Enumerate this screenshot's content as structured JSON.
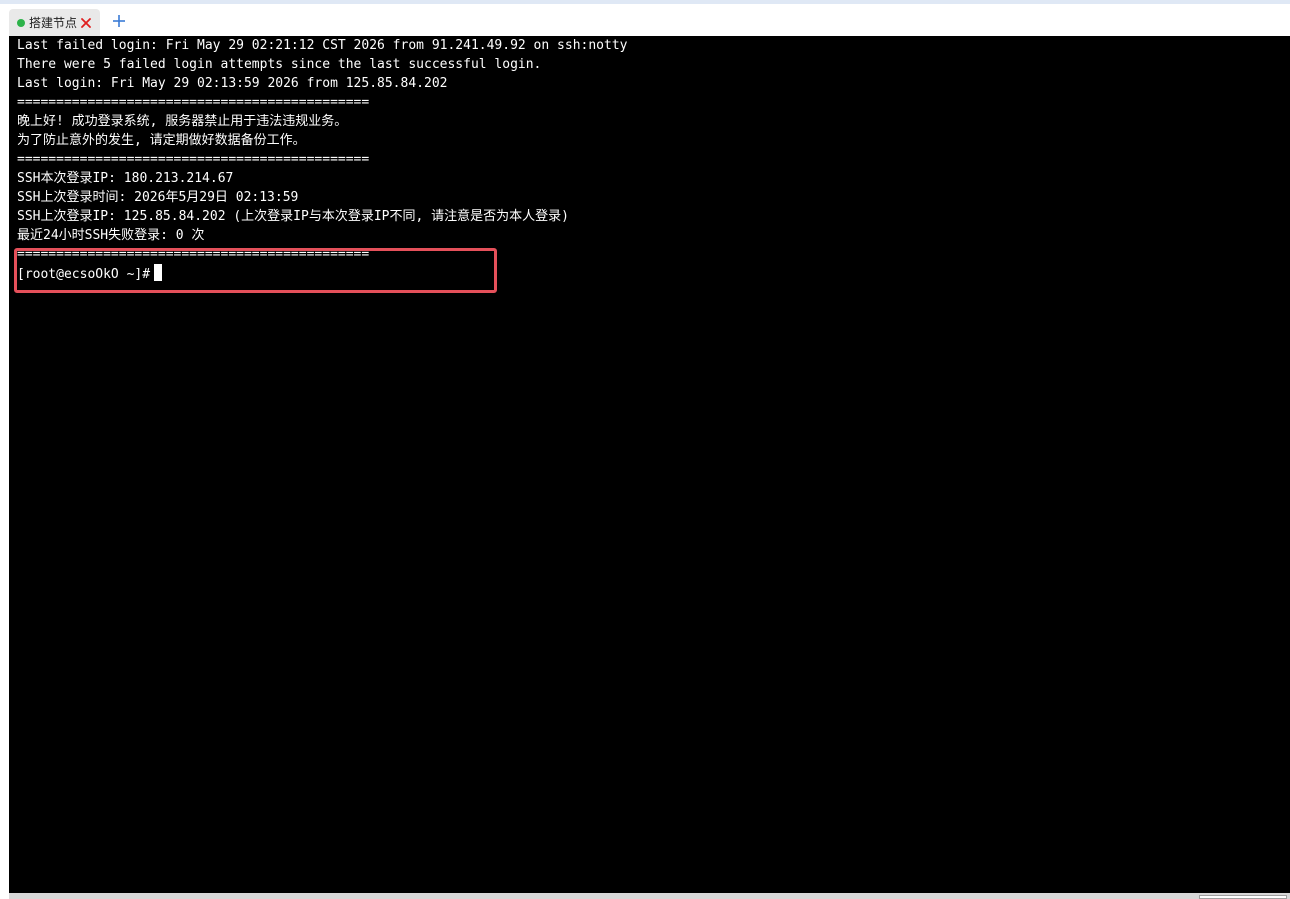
{
  "window": {
    "accent_color": "#dfe8f5"
  },
  "tabs": [
    {
      "label": "搭建节点",
      "status": "connected",
      "status_color": "#2db34a",
      "close_icon": "close-icon",
      "close_color": "#e02020"
    }
  ],
  "add_tab_icon": "plus-icon",
  "terminal": {
    "background": "#000000",
    "foreground": "#ffffff",
    "lines": [
      "Last failed login: Fri May 29 02:21:12 CST 2026 from 91.241.49.92 on ssh:notty",
      "There were 5 failed login attempts since the last successful login.",
      "Last login: Fri May 29 02:13:59 2026 from 125.85.84.202",
      "=============================================",
      "晚上好! 成功登录系统, 服务器禁止用于违法违规业务。",
      "为了防止意外的发生, 请定期做好数据备份工作。",
      "=============================================",
      "SSH本次登录IP: 180.213.214.67",
      "SSH上次登录时间: 2026年5月29日 02:13:59",
      "SSH上次登录IP: 125.85.84.202 (上次登录IP与本次登录IP不同, 请注意是否为本人登录)",
      "最近24小时SSH失败登录: 0 次",
      "============================================="
    ],
    "prompt": "[root@ecsoOkO ~]#",
    "highlight_color": "#e5505a"
  }
}
